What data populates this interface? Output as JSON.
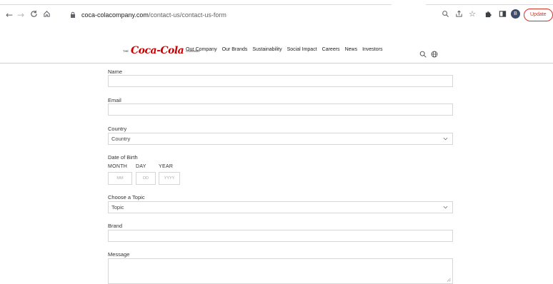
{
  "browser": {
    "url_host": "coca-colacompany.com",
    "url_path": "/contact-us/contact-us-form",
    "profile_initial": "B",
    "update_label": "Update"
  },
  "header": {
    "brand_the": "THE",
    "brand_script": "Coca-Cola",
    "brand_company": "COMPANY",
    "nav": [
      "Our Company",
      "Our Brands",
      "Sustainability",
      "Social Impact",
      "Careers",
      "News",
      "Investors"
    ]
  },
  "form": {
    "name_label": "Name",
    "email_label": "Email",
    "country_label": "Country",
    "country_value": "Country",
    "dob_label": "Date of Birth",
    "month_label": "MONTH",
    "day_label": "DAY",
    "year_label": "YEAR",
    "month_placeholder": "MM",
    "day_placeholder": "DD",
    "year_placeholder": "YYYY",
    "topic_label": "Choose a Topic",
    "topic_value": "Topic",
    "brand_label": "Brand",
    "message_label": "Message"
  },
  "colors": {
    "brand_red": "#cc0000",
    "update_red": "#d93025"
  }
}
